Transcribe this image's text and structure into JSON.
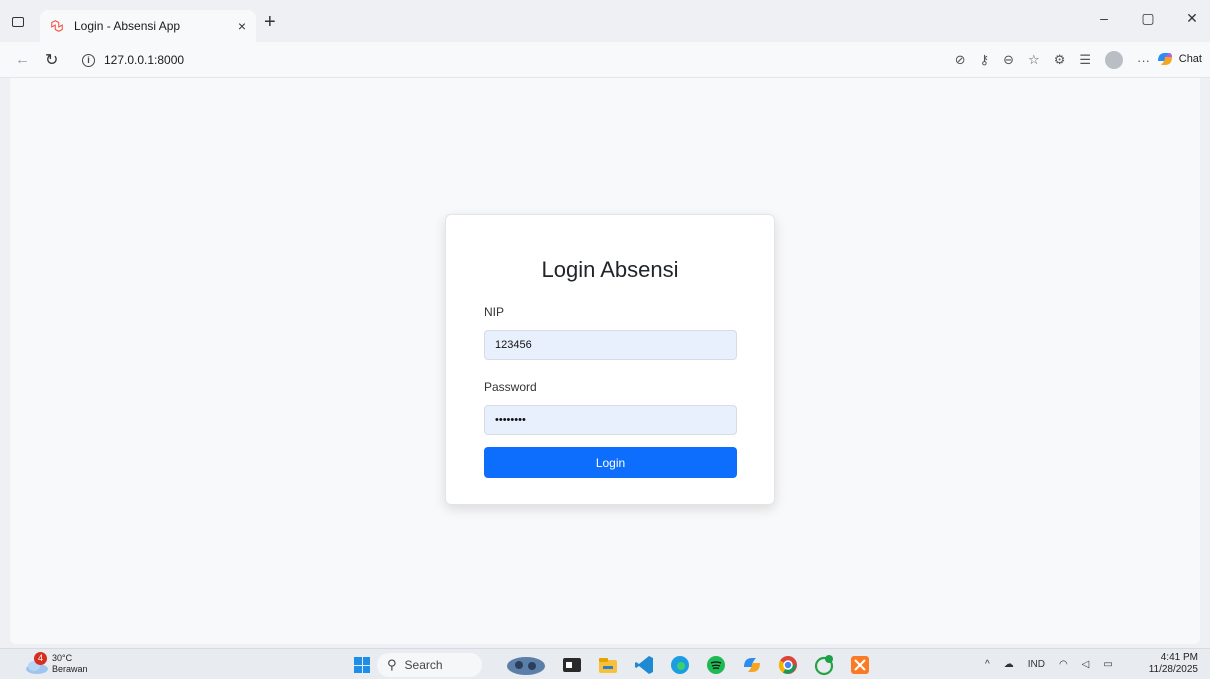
{
  "browser": {
    "tab_title": "Login - Absensi App",
    "tab_close": "×",
    "new_tab": "+",
    "url": "127.0.0.1:8000",
    "chat_label": "Chat",
    "window_controls": {
      "minimize": "–",
      "maximize": "▢",
      "close": "✕"
    }
  },
  "login": {
    "title": "Login Absensi",
    "nip_label": "NIP",
    "nip_value": "123456",
    "password_label": "Password",
    "password_value": "********",
    "button_label": "Login"
  },
  "taskbar": {
    "weather_temp": "30°C",
    "weather_desc": "Berawan",
    "weather_badge": "4",
    "search_placeholder": "Search",
    "language": "IND",
    "time": "4:41 PM",
    "date": "11/28/2025"
  },
  "colors": {
    "primary_button": "#0d6efd",
    "input_bg": "#e8f0fe",
    "page_bg": "#f8f9fa"
  },
  "icons": {
    "taskbar_apps": [
      "file-explorer-icon",
      "vscode-icon",
      "edge-icon",
      "spotify-icon",
      "copilot-icon",
      "chrome-icon",
      "whatsapp-icon",
      "xampp-icon"
    ]
  }
}
